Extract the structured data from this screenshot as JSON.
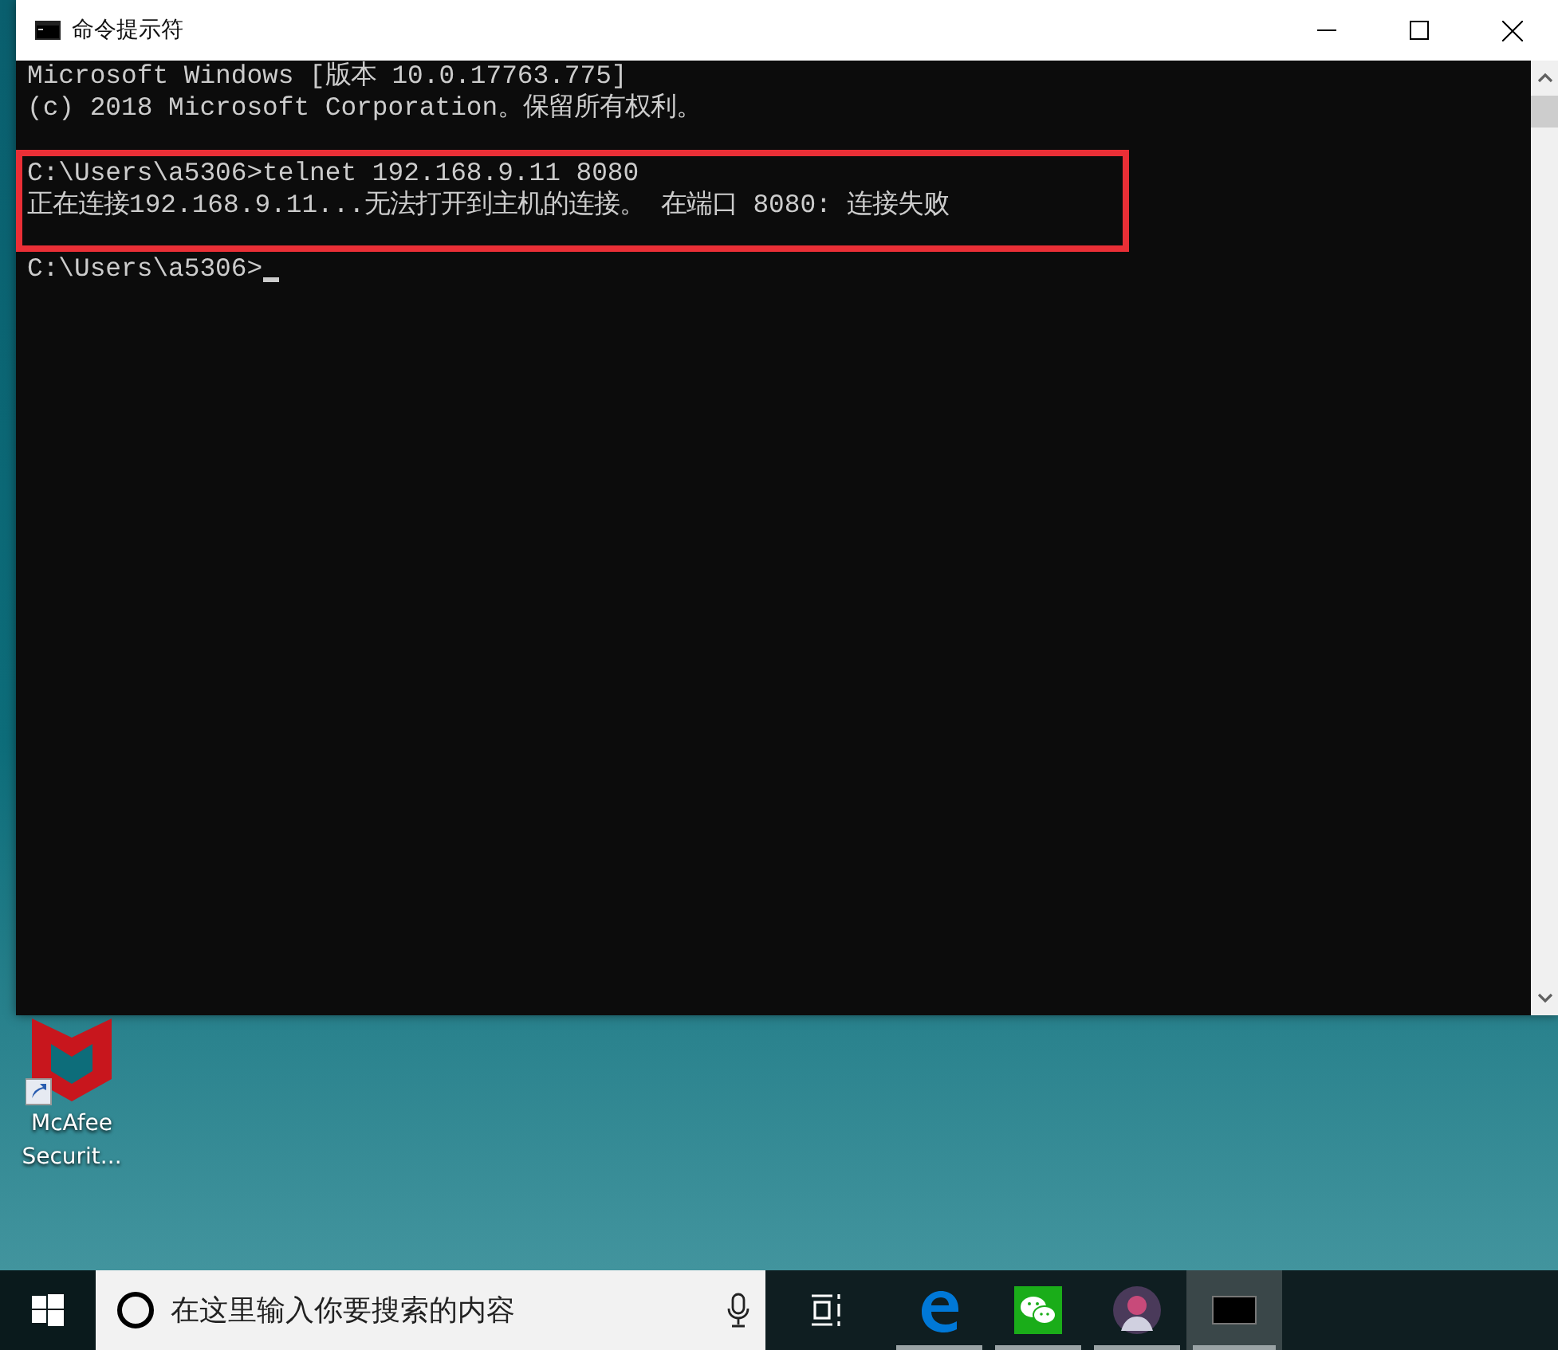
{
  "window": {
    "title": "命令提示符",
    "blocks": [
      [
        "Microsoft Windows [版本 10.0.17763.775]",
        "(c) 2018 Microsoft Corporation。保留所有权利。"
      ],
      [
        "C:\\Users\\a5306>telnet 192.168.9.11 8080",
        "正在连接192.168.9.11...无法打开到主机的连接。 在端口 8080: 连接失败"
      ],
      [
        "C:\\Users\\a5306>"
      ]
    ]
  },
  "desktop_icons": [
    {
      "kind": "shield",
      "label_lines": [
        "McAfee",
        "Securit..."
      ]
    }
  ],
  "taskbar": {
    "search": {
      "placeholder": "在这里输入你要搜索的内容"
    },
    "apps": [
      {
        "kind": "edge",
        "running": true,
        "active": false
      },
      {
        "kind": "chat",
        "running": true,
        "active": false
      },
      {
        "kind": "avatar",
        "running": true,
        "active": false
      },
      {
        "kind": "console",
        "running": true,
        "active": true
      }
    ]
  }
}
